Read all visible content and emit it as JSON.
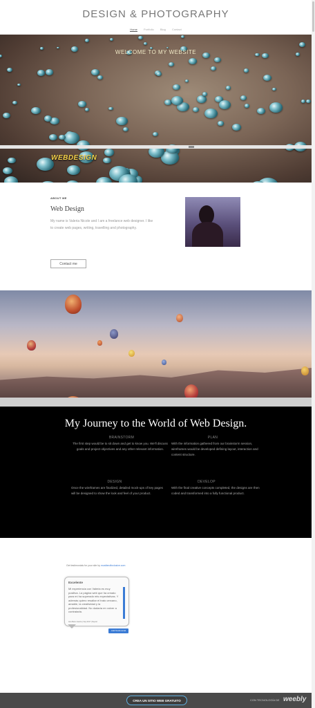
{
  "site": {
    "title": "DESIGN & PHOTOGRAPHY"
  },
  "nav": {
    "items": [
      "Home",
      "Portfolio",
      "Blog",
      "Contact"
    ],
    "active": "Home"
  },
  "hero": {
    "title": "WELCOME TO MY WEBSITE",
    "caption": "WEBDESIGN"
  },
  "about": {
    "label": "ABOUT ME",
    "heading": "Web Design",
    "text": "My name is  Valeria Nicole and I am a freelance web designer. I like to create web pages, writing, travelling  and photography.",
    "button": "Contact me"
  },
  "journey": {
    "title": "My Journey to the World of Web Design.",
    "steps": [
      {
        "heading": "BRAINSTORM",
        "text": "The first step would be to sit down and get to know you. We'll discuss goals and project objectives and any other relevant information."
      },
      {
        "heading": "PLAN",
        "text": "With the information gathered from our brainstorm session, wireframes would be developed defining layout, interaction and content structure."
      },
      {
        "heading": "DESIGN",
        "text": "Once the wireframes are finalized, detailed mock-ups of key pages will be designed to show the look and feel of your product."
      },
      {
        "heading": "DEVELOP",
        "text": "With the final creative concepts completed, the designs are then coded and transformed into a fully functional product."
      }
    ]
  },
  "testimonial": {
    "caption_prefix": "Get testimonials for your site by",
    "caption_link": "mustbeofinclusive.com",
    "title": "Excelente",
    "text": "Mi experiencia con Valeria es muy positiva. La página web que ha creado para mí ha superado mis expectativas. Y además quiero resaltar el trato cercano, amable, la creatividad y la profesionalidad. No dudaría en volver a contratarla.",
    "author": "Ana Belen Garcia | Sep 2017 | Report",
    "add_button": "Add Testimonial"
  },
  "footer": {
    "cta": "CREA UN SITIO WEB GRATUITO",
    "powered": "CON TECNOLOGÍA DE",
    "brand": "weebly"
  }
}
